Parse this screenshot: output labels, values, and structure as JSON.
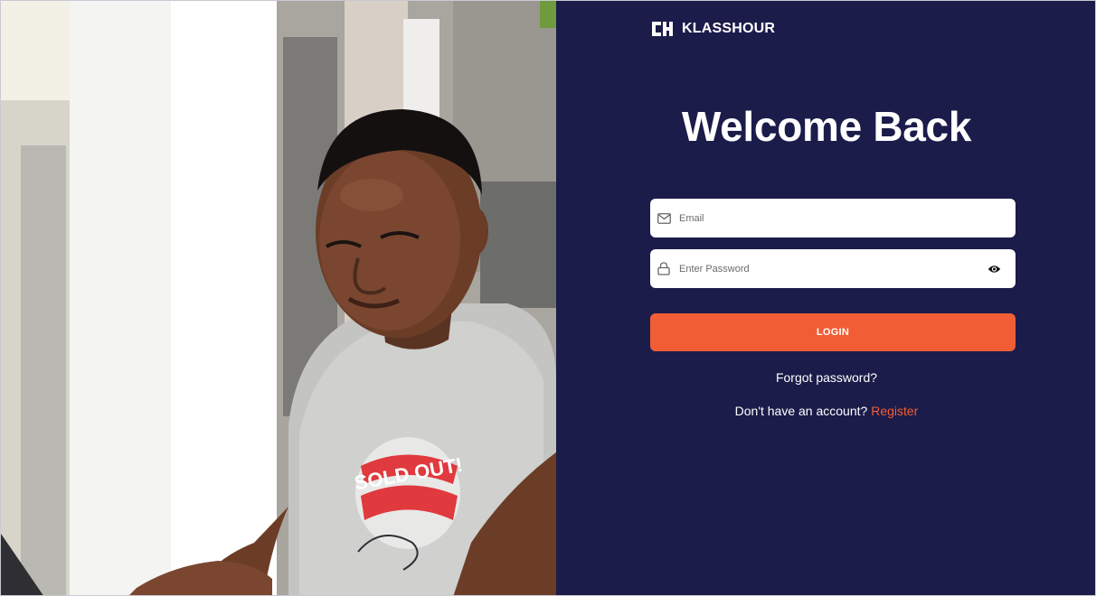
{
  "photo": {
    "shirt_text": "SOLD OUT!"
  },
  "brand": {
    "name": "KLASSHOUR",
    "logo_icon": "klasshour-logo-icon"
  },
  "login": {
    "title": "Welcome Back",
    "email": {
      "placeholder": "Email",
      "value": "",
      "icon": "mail-icon"
    },
    "password": {
      "placeholder": "Enter Password",
      "value": "",
      "icon": "lock-icon",
      "toggle_icon": "eye-icon"
    },
    "submit_label": "LOGIN",
    "forgot_label": "Forgot password?",
    "register_prompt": "Don't have an account?",
    "register_label": "Register"
  },
  "colors": {
    "panel_background": "#1b1c4a",
    "accent": "#f15e36",
    "text": "#ffffff",
    "input_background": "#ffffff"
  }
}
